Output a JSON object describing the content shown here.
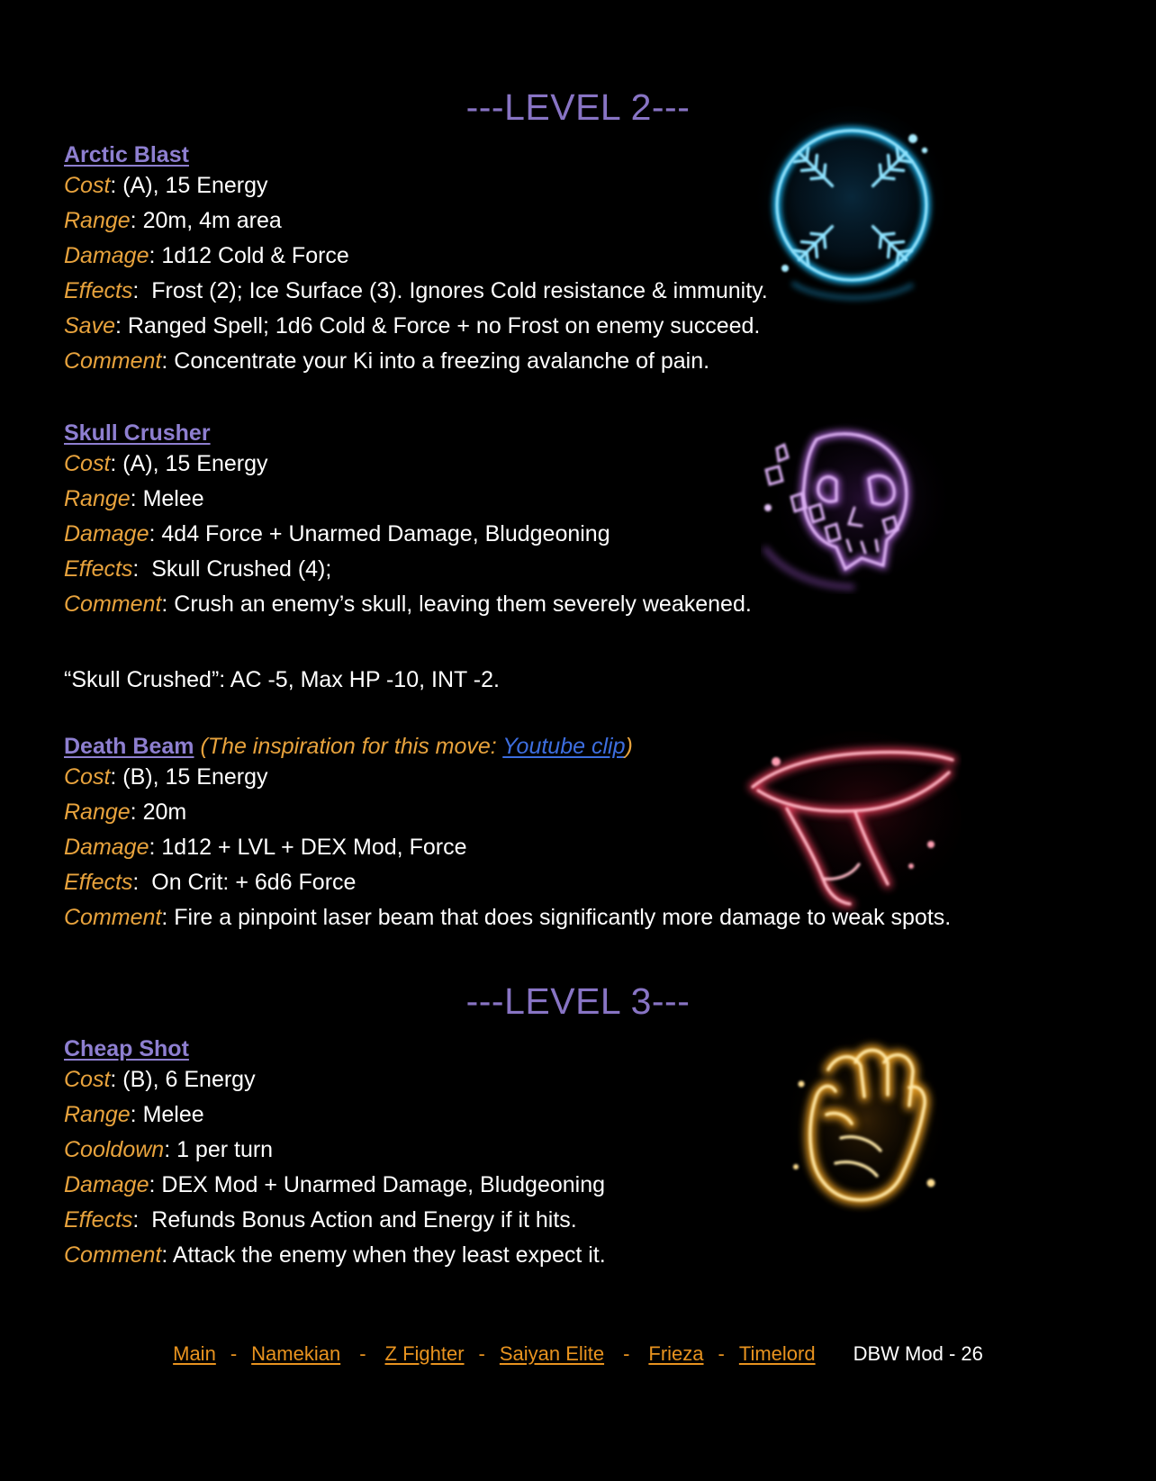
{
  "document": {
    "background_color": "#000000",
    "heading_color": "#8874c4",
    "ability_title_color": "#8e7fd0",
    "label_color": "#e8a33d",
    "link_color": "#3d6ee0",
    "footer_link_color": "#e8931f",
    "body_text_color": "#ffffff"
  },
  "sections": [
    {
      "heading": "---LEVEL 2---"
    },
    {
      "heading": "---LEVEL 3---"
    }
  ],
  "abilities": {
    "arctic_blast": {
      "name": "Arctic Blast",
      "cost_label": "Cost",
      "cost_value": ": (A), 15 Energy",
      "range_label": "Range",
      "range_value": ": 20m, 4m area",
      "damage_label": "Damage",
      "damage_value": ": 1d12 Cold & Force",
      "effects_label": "Effects",
      "effects_value": ":  Frost (2); Ice Surface (3). Ignores Cold resistance & immunity.",
      "save_label": "Save",
      "save_value": ": Ranged Spell; 1d6 Cold & Force + no Frost on enemy succeed.",
      "comment_label": "Comment",
      "comment_value": ": Concentrate your Ki into a freezing avalanche of pain.",
      "icon": "frost-orb-icon"
    },
    "skull_crusher": {
      "name": "Skull Crusher",
      "cost_label": "Cost",
      "cost_value": ": (A), 15 Energy",
      "range_label": "Range",
      "range_value": ": Melee",
      "damage_label": "Damage",
      "damage_value": ": 4d4 Force + Unarmed Damage, Bludgeoning",
      "effects_label": "Effects",
      "effects_value": ":  Skull Crushed (4);",
      "comment_label": "Comment",
      "comment_value": ": Crush an enemy’s skull, leaving them severely weakened.",
      "status_note": "“Skull Crushed”: AC -5, Max HP -10, INT -2.",
      "icon": "skull-icon"
    },
    "death_beam": {
      "name": "Death Beam",
      "note_prefix": " (The inspiration for this move: ",
      "note_link": "Youtube clip",
      "note_suffix": ")",
      "cost_label": "Cost",
      "cost_value": ": (B), 15 Energy",
      "range_label": "Range",
      "range_value": ": 20m",
      "damage_label": "Damage",
      "damage_value": ": 1d12 + LVL + DEX Mod, Force",
      "effects_label": "Effects",
      "effects_value": ":  On Crit: + 6d6 Force",
      "comment_label": "Comment",
      "comment_value": ": Fire a pinpoint laser beam that does significantly more damage to weak spots.",
      "icon": "laser-hand-icon"
    },
    "cheap_shot": {
      "name": "Cheap Shot",
      "cost_label": "Cost",
      "cost_value": ": (B), 6 Energy",
      "range_label": "Range",
      "range_value": ": Melee",
      "cooldown_label": "Cooldown",
      "cooldown_value": ": 1 per turn",
      "damage_label": "Damage",
      "damage_value": ": DEX Mod + Unarmed Damage, Bludgeoning",
      "effects_label": "Effects",
      "effects_value": ":  Refunds Bonus Action and Energy if it hits.",
      "comment_label": "Comment",
      "comment_value": ": Attack the enemy when they least expect it.",
      "icon": "golden-fist-icon"
    }
  },
  "footer": {
    "links": [
      "Main",
      "Namekian",
      "Z Fighter",
      "Saiyan Elite",
      "Frieza",
      "Timelord"
    ],
    "separator": "-",
    "mod_label": "DBW Mod - 26"
  }
}
